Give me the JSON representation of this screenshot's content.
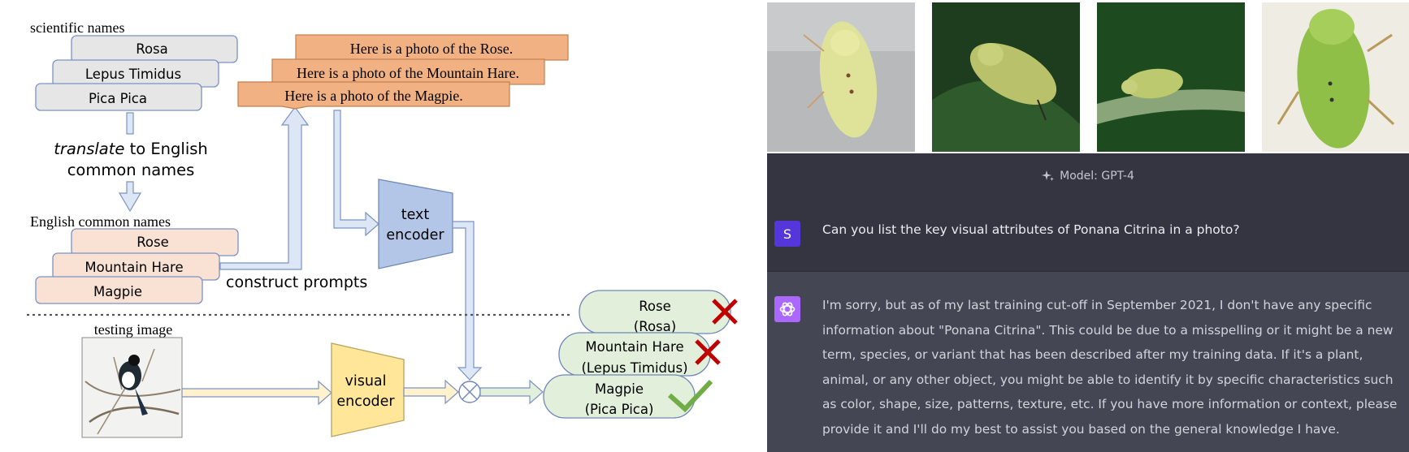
{
  "diagram": {
    "scientific_header": "scientific names",
    "scientific_names": [
      "Rosa",
      "Lepus Timidus",
      "Pica Pica"
    ],
    "translate_italic": "translate",
    "translate_rest": " to English",
    "translate_line2": "common names",
    "english_header": "English common names",
    "english_names": [
      "Rose",
      "Mountain Hare",
      "Magpie"
    ],
    "prompts": [
      "Here is a photo of the Rose.",
      "Here is a photo of the Mountain Hare.",
      "Here is a photo of the Magpie."
    ],
    "construct_label": "construct prompts",
    "text_encoder": [
      "text",
      "encoder"
    ],
    "testing_image_label": "testing image",
    "visual_encoder": [
      "visual",
      "encoder"
    ],
    "results": [
      {
        "line1": "Rose",
        "line2": "(Rosa)",
        "mark": "cross"
      },
      {
        "line1": "Mountain Hare",
        "line2": "(Lepus Timidus)",
        "mark": "cross"
      },
      {
        "line1": "Magpie",
        "line2": "(Pica Pica)",
        "mark": "check"
      }
    ],
    "colors": {
      "gray_box": "#e6e6e6",
      "peach_box": "#f9e1d4",
      "orange_box": "#f1b183",
      "encoder_blue": "#b4c6e7",
      "encoder_yellow": "#ffe699",
      "result_green": "#e2efda",
      "cross_red": "#c00000",
      "check_green": "#70ad47"
    }
  },
  "photos": {
    "icons": [
      "leafhopper-photo-1",
      "leafhopper-photo-2",
      "leafhopper-photo-3",
      "leafhopper-photo-4"
    ]
  },
  "chat": {
    "model_label": "Model: GPT-4",
    "user_initial": "S",
    "user_message": "Can you list the key visual attributes of Ponana Citrina in a photo?",
    "assistant_message": "I'm sorry, but as of my last training cut-off in September 2021, I don't have any specific information about \"Ponana Citrina\". This could be due to a misspelling or it might be a new term, species, or variant that has been described after my training data. If it's a plant, animal, or any other object, you might be able to identify it by specific characteristics such as color, shape, size, patterns, texture, etc. If you have more information or context, please provide it and I'll do my best to assist you based on the general knowledge I have.",
    "colors": {
      "header_bg": "#343541",
      "assistant_bg": "#444654",
      "user_avatar": "#5436da",
      "assistant_avatar": "#ab68ff"
    }
  }
}
